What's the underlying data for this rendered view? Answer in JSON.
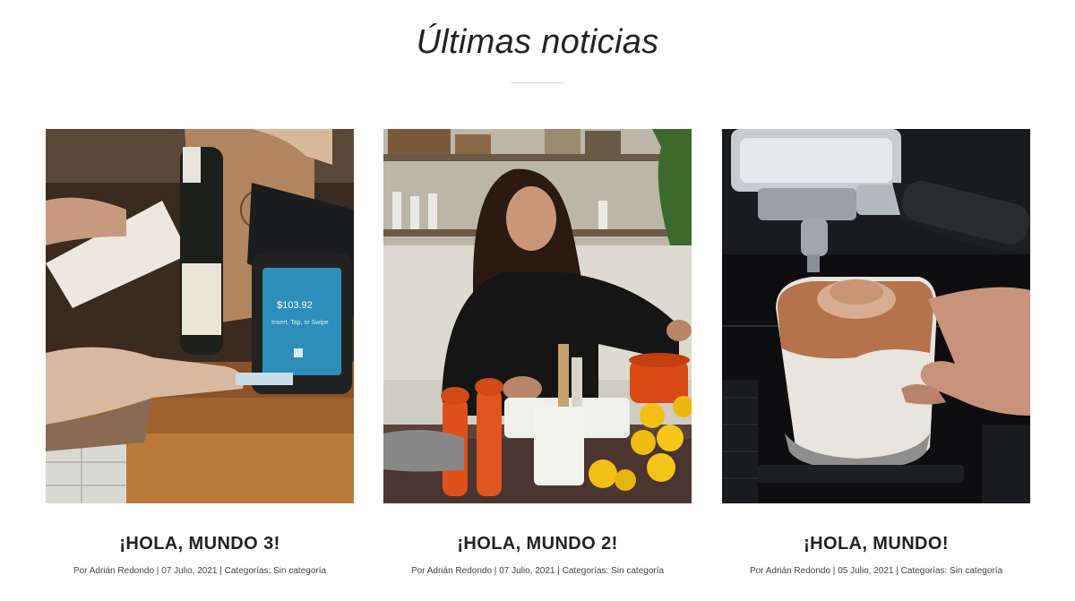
{
  "section": {
    "title": "Últimas noticias"
  },
  "posts": [
    {
      "title": "¡HOLA, MUNDO 3!",
      "meta_prefix": "Por",
      "author": "Adrián Redondo",
      "date": "07 Julio, 2021",
      "categories_label": "Categorías:",
      "category": "Sin categoría",
      "image_text": "$103.92",
      "image_subtext": "Insert, Tap, or Swipe"
    },
    {
      "title": "¡HOLA, MUNDO 2!",
      "meta_prefix": "Por",
      "author": "Adrián Redondo",
      "date": "07 Julio, 2021",
      "categories_label": "Categorías:",
      "category": "Sin categoría"
    },
    {
      "title": "¡HOLA, MUNDO!",
      "meta_prefix": "Por",
      "author": "Adrián Redondo",
      "date": "05 Julio, 2021",
      "categories_label": "Categorías:",
      "category": "Sin categoría"
    }
  ],
  "meta_separator": "|"
}
